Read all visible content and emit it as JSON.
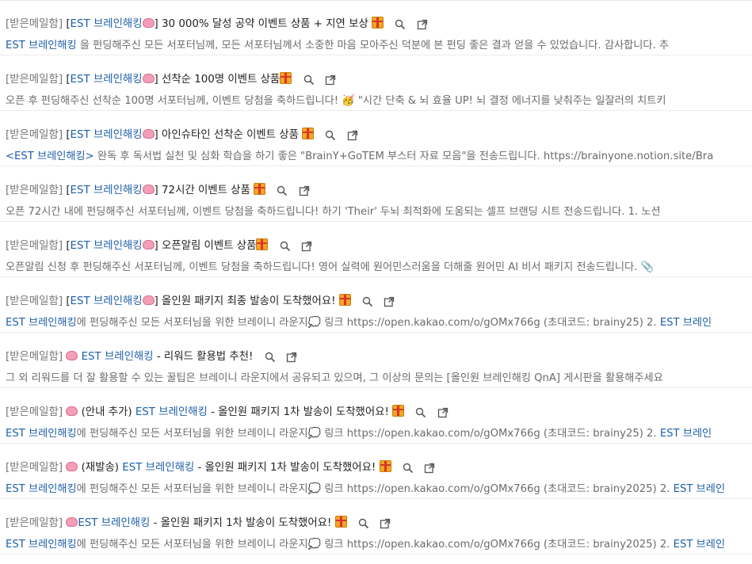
{
  "labels": {
    "mailbox": "[받은메일함]",
    "brand": "EST 브레인해킹"
  },
  "emails": [
    {
      "subject_pre": "[",
      "subject_post": "] 30 000% 달성 공약 이벤트 상품 + 지연 보상",
      "preview_brand": "EST 브레인해킹",
      "preview": " 을 펀딩해주신 모든 서포터님께, 모든 서포터님께서 소중한 마음 모아주신 덕분에 본 펀딩 좋은 결과 얻을 수 있었습니다. 감사합니다. 추"
    },
    {
      "subject_pre": "[",
      "subject_post": "] 선착순 100명 이벤트 상품",
      "preview_brand": "",
      "preview": "오픈 후 펀딩해주신 선착순 100명 서포터님께, 이벤트 당첨을 축하드립니다! 🥳 \"시간 단축 & 뇌 효율 UP! 뇌 결정 에너지를 낮춰주는 일잘러의 치트키"
    },
    {
      "subject_pre": "[",
      "subject_post": "] 아인슈타인 선착순 이벤트 상품",
      "preview_brand": "<EST 브레인해킹>",
      "preview": " 완독 후 독서법 실천 및 심화 학습을 하기 좋은 \"BrainY+GoTEM 부스터 자료 모음\"을 전송드립니다. https://brainyone.notion.site/Bra"
    },
    {
      "subject_pre": "[",
      "subject_post": "] 72시간 이벤트 상품",
      "preview_brand": "",
      "preview": "오픈 72시간 내에 펀딩해주신 서포터님께, 이벤트 당첨을 축하드립니다!  하기 'Their' 두뇌 최적화에 도움되는 셀프 브랜딩 시트 전송드립니다.  1. 노션"
    },
    {
      "subject_pre": "[",
      "subject_post": "] 오픈알림 이벤트 상품",
      "preview_brand": "",
      "preview": "오픈알림 신청 후 펀딩해주신 서포터님께, 이벤트 당첨을 축하드립니다!  영어 실력에 원어민스러움을 더해줄 원어민 AI 비서 패키지 전송드립니다. 📎"
    },
    {
      "subject_pre": "[",
      "subject_post": "] 올인원 패키지 최종 발송이 도착했어요!",
      "preview_brand": "EST 브레인해킹",
      "preview": "에 펀딩해주신 모든 서포터님을 위한 브레이니 라운지💭 링크 https://open.kakao.com/o/gOMx766g (초대코드: brainy25) 2. ",
      "preview_tail_brand": "EST 브레인"
    },
    {
      "subject_pre": "",
      "subject_post": " - 리워드 활용법 추천!",
      "preview_brand": "",
      "preview": "그 외 리워드를 더 잘 활용할 수 있는 꿀팁은 브레이니 라운지에서 공유되고 있으며, 그 이상의 문의는 [올인원 브레인해킹 QnA] 게시판을 활용해주세요"
    },
    {
      "subject_pre": "(안내 추가) ",
      "subject_post": " - 올인원 패키지 1차 발송이 도착했어요!",
      "preview_brand": "EST 브레인해킹",
      "preview": "에 펀딩해주신 모든 서포터님을 위한 브레이니 라운지💭 링크 https://open.kakao.com/o/gOMx766g (초대코드: brainy25) 2. ",
      "preview_tail_brand": "EST 브레인"
    },
    {
      "subject_pre": "(재발송) ",
      "subject_post": " - 올인원 패키지 1차 발송이 도착했어요!",
      "preview_brand": "EST 브레인해킹",
      "preview": "에 펀딩해주신 모든 서포터님을 위한 브레이니 라운지💭 링크 https://open.kakao.com/o/gOMx766g (초대코드: brainy2025) 2. ",
      "preview_tail_brand": "EST 브레인"
    },
    {
      "subject_pre": "",
      "subject_post": " - 올인원 패키지 1차 발송이 도착했어요!",
      "preview_brand": "EST 브레인해킹",
      "preview": "에 펀딩해주신 모든 서포터님을 위한 브레이니 라운지💭 링크 https://open.kakao.com/o/gOMx766g (초대코드: brainy2025) 2. ",
      "preview_tail_brand": "EST 브레인"
    }
  ],
  "icons": {
    "brain": "brain-icon",
    "gift": "gift-icon",
    "search": "search-icon",
    "open": "open-new-window-icon"
  },
  "colors": {
    "brand_link": "#1e5fa8",
    "mailbox_label": "#757575",
    "preview_text": "#6b6b6b"
  }
}
